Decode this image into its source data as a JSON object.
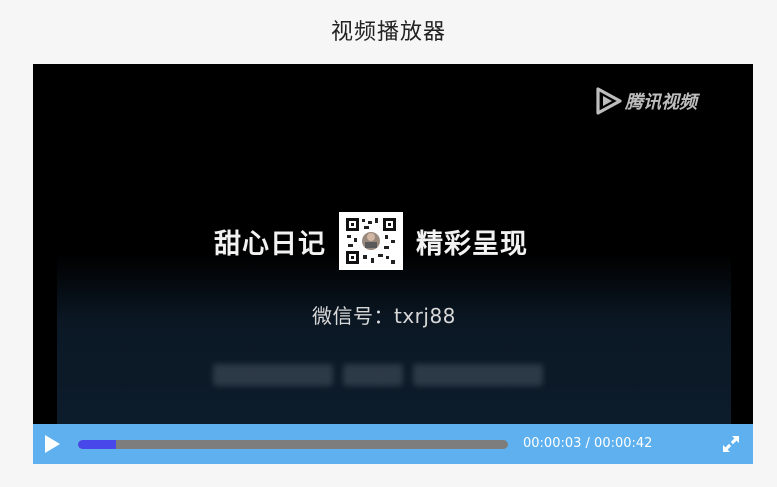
{
  "page": {
    "title": "视频播放器"
  },
  "video": {
    "watermark_text": "腾讯视频",
    "headline_left": "甜心日记",
    "headline_right": "精彩呈现",
    "wechat_id": "微信号：txrj88"
  },
  "controls": {
    "current_time": "00:00:03",
    "separator": " / ",
    "duration": "00:00:42",
    "progress_fraction": 0.089,
    "play_icon": "play-icon",
    "fullscreen_icon": "fullscreen-icon"
  },
  "colors": {
    "control_bar": "#5eb0ef",
    "progress_fill": "#4848ea",
    "progress_track": "#7d7d7d",
    "video_background": "#000000"
  }
}
